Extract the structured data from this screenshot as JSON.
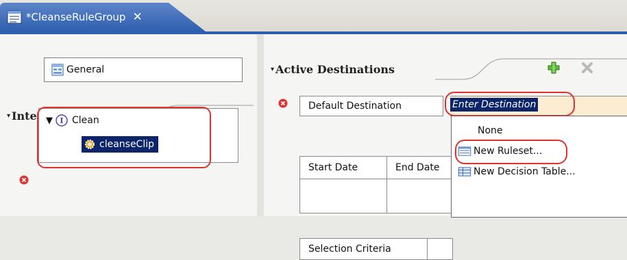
{
  "tab": {
    "title": "*CleanseRuleGroup",
    "close_glyph": "✕",
    "icon": "rule-group-icon"
  },
  "left": {
    "general_label": "General",
    "interfaces_heading": "Interfaces",
    "interface_name": "Clean",
    "operation_name": "cleanseClip"
  },
  "right": {
    "active_destinations_heading": "Active Destinations",
    "default_destination_label": "Default Destination",
    "destination_value": "Enter Destination",
    "table_headers": [
      "Start Date",
      "End Date"
    ],
    "lower_header": "Selection Criteria"
  },
  "dropdown": {
    "items": [
      "None",
      "New Ruleset...",
      "New Decision Table..."
    ]
  },
  "colors": {
    "selection": "#0b246a",
    "tab_blue": "#2e5fae",
    "highlight_oval": "#e03030",
    "input_bg": "#fcecd2"
  }
}
